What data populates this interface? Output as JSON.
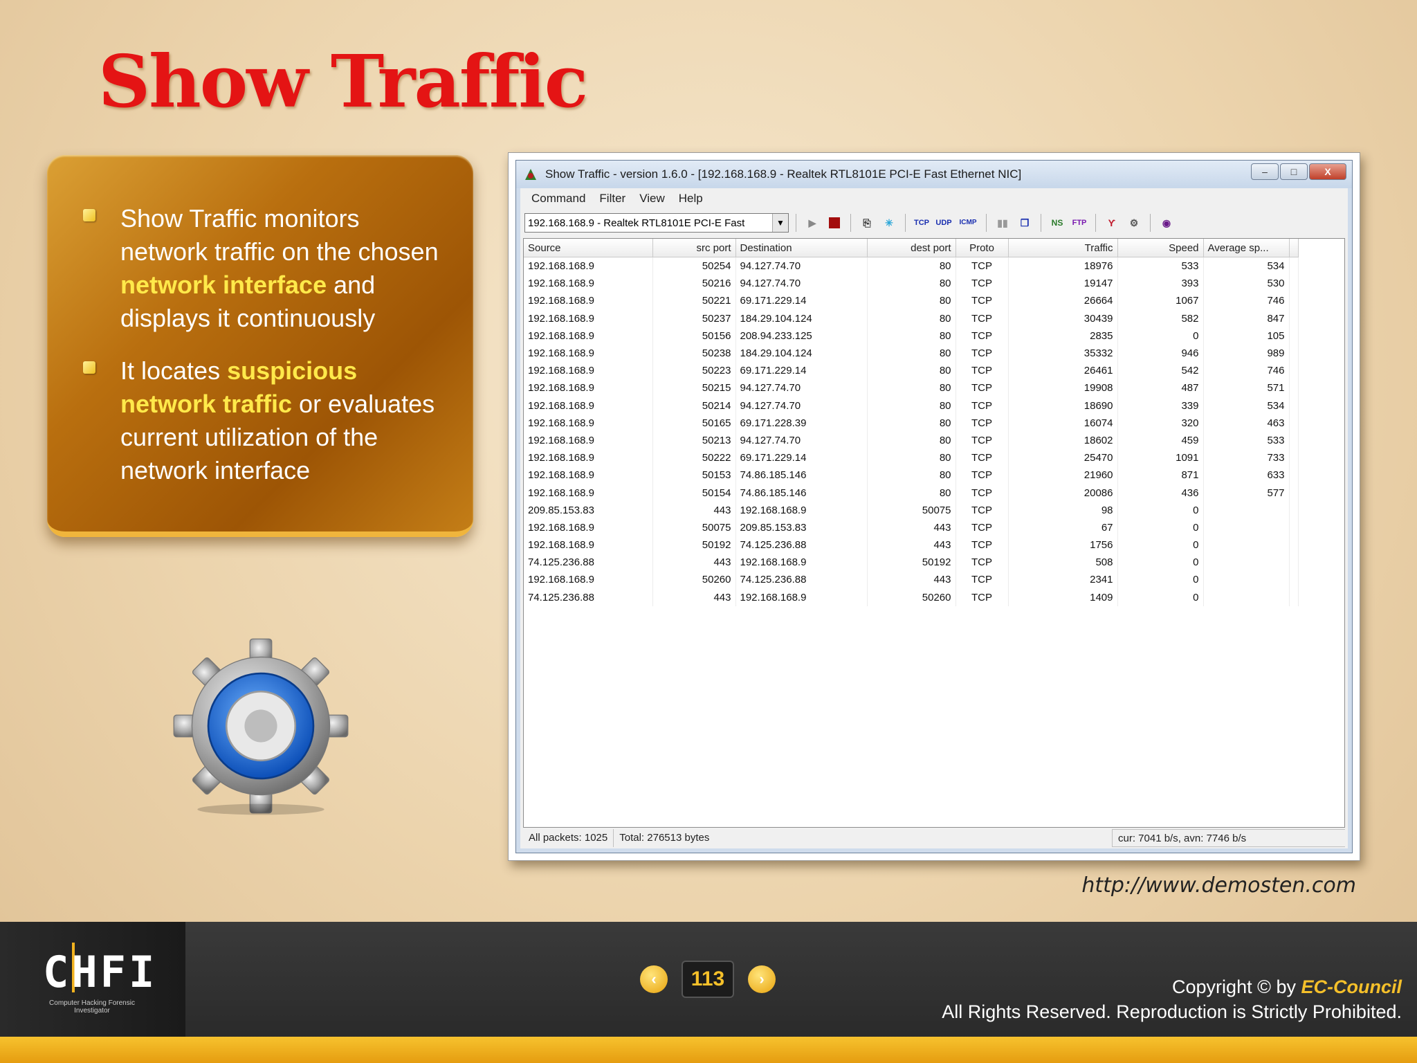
{
  "slide": {
    "title": "Show Traffic",
    "bullets": [
      {
        "before": "Show Traffic monitors network traffic on the chosen ",
        "highlight": "network interface",
        "after": " and displays it continuously"
      },
      {
        "before": "It locates ",
        "highlight": "suspicious network traffic",
        "after": " or evaluates current utilization of the network interface"
      }
    ],
    "source_url": "http://www.demosten.com"
  },
  "app": {
    "title": "Show Traffic - version 1.6.0 - [192.168.168.9 - Realtek RTL8101E PCI-E Fast Ethernet NIC]",
    "window_buttons": {
      "minimize": "–",
      "maximize": "□",
      "close": "X"
    },
    "menu": [
      "Command",
      "Filter",
      "View",
      "Help"
    ],
    "interface_select": "192.168.168.9 - Realtek RTL8101E PCI-E Fast",
    "toolbar_labels": {
      "tcp": "TCP",
      "udp": "UDP",
      "icmp": "ICMP",
      "ns": "NS",
      "ftp": "FTP"
    },
    "columns": [
      "Source",
      "src port",
      "Destination",
      "dest port",
      "Proto",
      "Traffic",
      "Speed",
      "Average sp..."
    ],
    "rows": [
      [
        "192.168.168.9",
        "50254",
        "94.127.74.70",
        "80",
        "TCP",
        "18976",
        "533",
        "534"
      ],
      [
        "192.168.168.9",
        "50216",
        "94.127.74.70",
        "80",
        "TCP",
        "19147",
        "393",
        "530"
      ],
      [
        "192.168.168.9",
        "50221",
        "69.171.229.14",
        "80",
        "TCP",
        "26664",
        "1067",
        "746"
      ],
      [
        "192.168.168.9",
        "50237",
        "184.29.104.124",
        "80",
        "TCP",
        "30439",
        "582",
        "847"
      ],
      [
        "192.168.168.9",
        "50156",
        "208.94.233.125",
        "80",
        "TCP",
        "2835",
        "0",
        "105"
      ],
      [
        "192.168.168.9",
        "50238",
        "184.29.104.124",
        "80",
        "TCP",
        "35332",
        "946",
        "989"
      ],
      [
        "192.168.168.9",
        "50223",
        "69.171.229.14",
        "80",
        "TCP",
        "26461",
        "542",
        "746"
      ],
      [
        "192.168.168.9",
        "50215",
        "94.127.74.70",
        "80",
        "TCP",
        "19908",
        "487",
        "571"
      ],
      [
        "192.168.168.9",
        "50214",
        "94.127.74.70",
        "80",
        "TCP",
        "18690",
        "339",
        "534"
      ],
      [
        "192.168.168.9",
        "50165",
        "69.171.228.39",
        "80",
        "TCP",
        "16074",
        "320",
        "463"
      ],
      [
        "192.168.168.9",
        "50213",
        "94.127.74.70",
        "80",
        "TCP",
        "18602",
        "459",
        "533"
      ],
      [
        "192.168.168.9",
        "50222",
        "69.171.229.14",
        "80",
        "TCP",
        "25470",
        "1091",
        "733"
      ],
      [
        "192.168.168.9",
        "50153",
        "74.86.185.146",
        "80",
        "TCP",
        "21960",
        "871",
        "633"
      ],
      [
        "192.168.168.9",
        "50154",
        "74.86.185.146",
        "80",
        "TCP",
        "20086",
        "436",
        "577"
      ],
      [
        "209.85.153.83",
        "443",
        "192.168.168.9",
        "50075",
        "TCP",
        "98",
        "0",
        ""
      ],
      [
        "192.168.168.9",
        "50075",
        "209.85.153.83",
        "443",
        "TCP",
        "67",
        "0",
        ""
      ],
      [
        "192.168.168.9",
        "50192",
        "74.125.236.88",
        "443",
        "TCP",
        "1756",
        "0",
        ""
      ],
      [
        "74.125.236.88",
        "443",
        "192.168.168.9",
        "50192",
        "TCP",
        "508",
        "0",
        ""
      ],
      [
        "192.168.168.9",
        "50260",
        "74.125.236.88",
        "443",
        "TCP",
        "2341",
        "0",
        ""
      ],
      [
        "74.125.236.88",
        "443",
        "192.168.168.9",
        "50260",
        "TCP",
        "1409",
        "0",
        ""
      ]
    ],
    "status": {
      "packets": "All packets: 1025",
      "total": "Total: 276513 bytes",
      "rate": "cur: 7041 b/s, avn: 7746 b/s"
    }
  },
  "footer": {
    "logo": "CHFI",
    "logo_sub": "Computer Hacking Forensic Investigator",
    "page": "113",
    "copyright_prefix": "Copyright © by ",
    "brand": "EC-Council",
    "rights": "All Rights Reserved. Reproduction is Strictly Prohibited."
  }
}
